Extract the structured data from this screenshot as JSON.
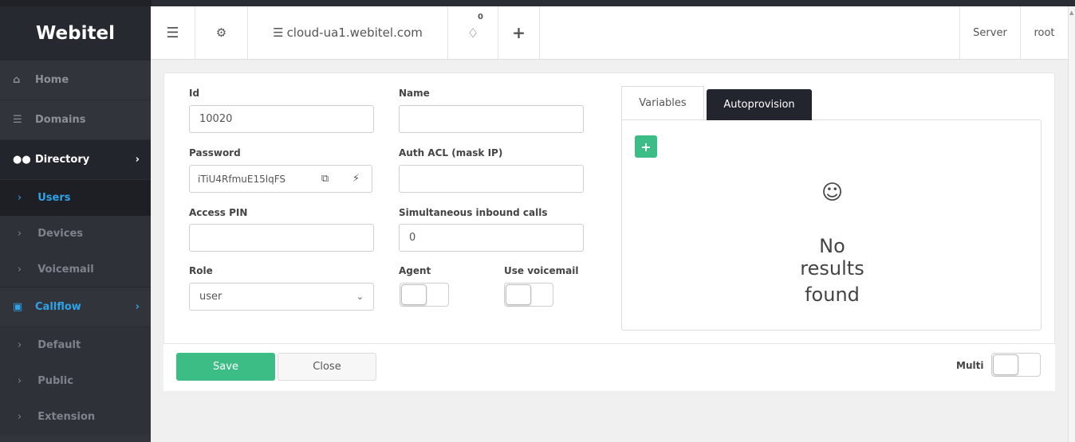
{
  "brand": "Webitel",
  "sidebar": {
    "items": [
      {
        "label": "Home"
      },
      {
        "label": "Domains"
      },
      {
        "label": "Directory"
      },
      {
        "label": "Users"
      },
      {
        "label": "Devices"
      },
      {
        "label": "Voicemail"
      },
      {
        "label": "Callflow"
      },
      {
        "label": "Default"
      },
      {
        "label": "Public"
      },
      {
        "label": "Extension"
      }
    ]
  },
  "topbar": {
    "domain": "cloud-ua1.webitel.com",
    "notifications_count": "0",
    "server_label": "Server",
    "user_label": "root"
  },
  "form": {
    "id_label": "Id",
    "id_value": "10020",
    "name_label": "Name",
    "name_value": "",
    "password_label": "Password",
    "password_value": "iTiU4RfmuE15lqFS",
    "auth_acl_label": "Auth ACL (mask IP)",
    "auth_acl_value": "",
    "access_pin_label": "Access PIN",
    "access_pin_value": "",
    "simultaneous_label": "Simultaneous inbound calls",
    "simultaneous_value": "0",
    "role_label": "Role",
    "role_value": "user",
    "agent_label": "Agent",
    "voicemail_label": "Use voicemail"
  },
  "tabs": {
    "variables": "Variables",
    "autoprovision": "Autoprovision",
    "empty_line1": "No",
    "empty_line2": "results",
    "empty_line3": "found"
  },
  "footer": {
    "save": "Save",
    "close": "Close",
    "multi": "Multi"
  },
  "colors": {
    "accent_green": "#3cbd85",
    "accent_blue": "#2fa3e8",
    "sidebar_bg": "#31343b",
    "tab_dark": "#22252d"
  }
}
